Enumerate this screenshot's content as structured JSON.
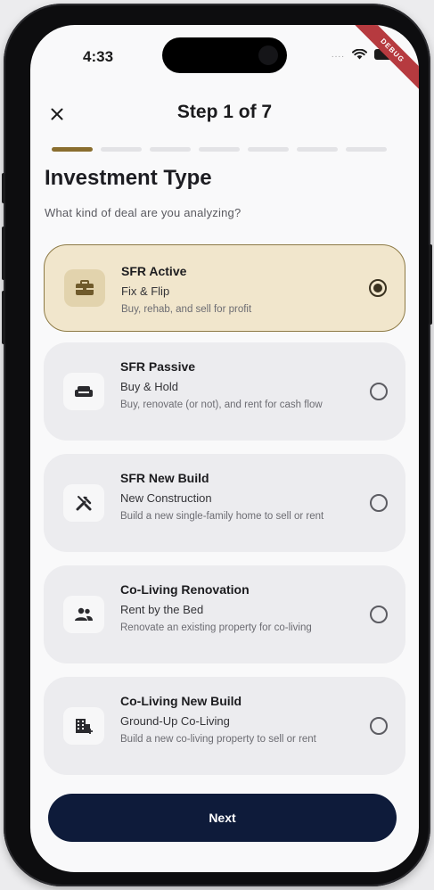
{
  "status_bar": {
    "time": "4:33",
    "signal_dots": "....",
    "debug_banner": "DEBUG"
  },
  "header": {
    "title": "Step 1 of 7"
  },
  "progress": {
    "current_step": 1,
    "total_steps": 7
  },
  "page": {
    "heading": "Investment Type",
    "subheading": "What kind of deal are you analyzing?"
  },
  "options": [
    {
      "title": "SFR Active",
      "subtitle": "Fix & Flip",
      "description": "Buy, rehab, and sell for profit",
      "icon": "briefcase-icon",
      "selected": true
    },
    {
      "title": "SFR Passive",
      "subtitle": "Buy & Hold",
      "description": "Buy, renovate (or not), and rent for cash flow",
      "icon": "sofa-icon",
      "selected": false
    },
    {
      "title": "SFR New Build",
      "subtitle": "New Construction",
      "description": "Build a new single-family home to sell or rent",
      "icon": "tools-icon",
      "selected": false
    },
    {
      "title": "Co-Living Renovation",
      "subtitle": "Rent by the Bed",
      "description": "Renovate an existing property for co-living",
      "icon": "people-icon",
      "selected": false
    },
    {
      "title": "Co-Living New Build",
      "subtitle": "Ground-Up Co-Living",
      "description": "Build a new co-living property to sell or rent",
      "icon": "building-add-icon",
      "selected": false
    }
  ],
  "footer": {
    "next_label": "Next"
  },
  "colors": {
    "accent": "#8a6e2f",
    "selected_bg": "#f1e6cc",
    "primary_button": "#0e1b3a",
    "debug_banner": "#b63a3f"
  }
}
